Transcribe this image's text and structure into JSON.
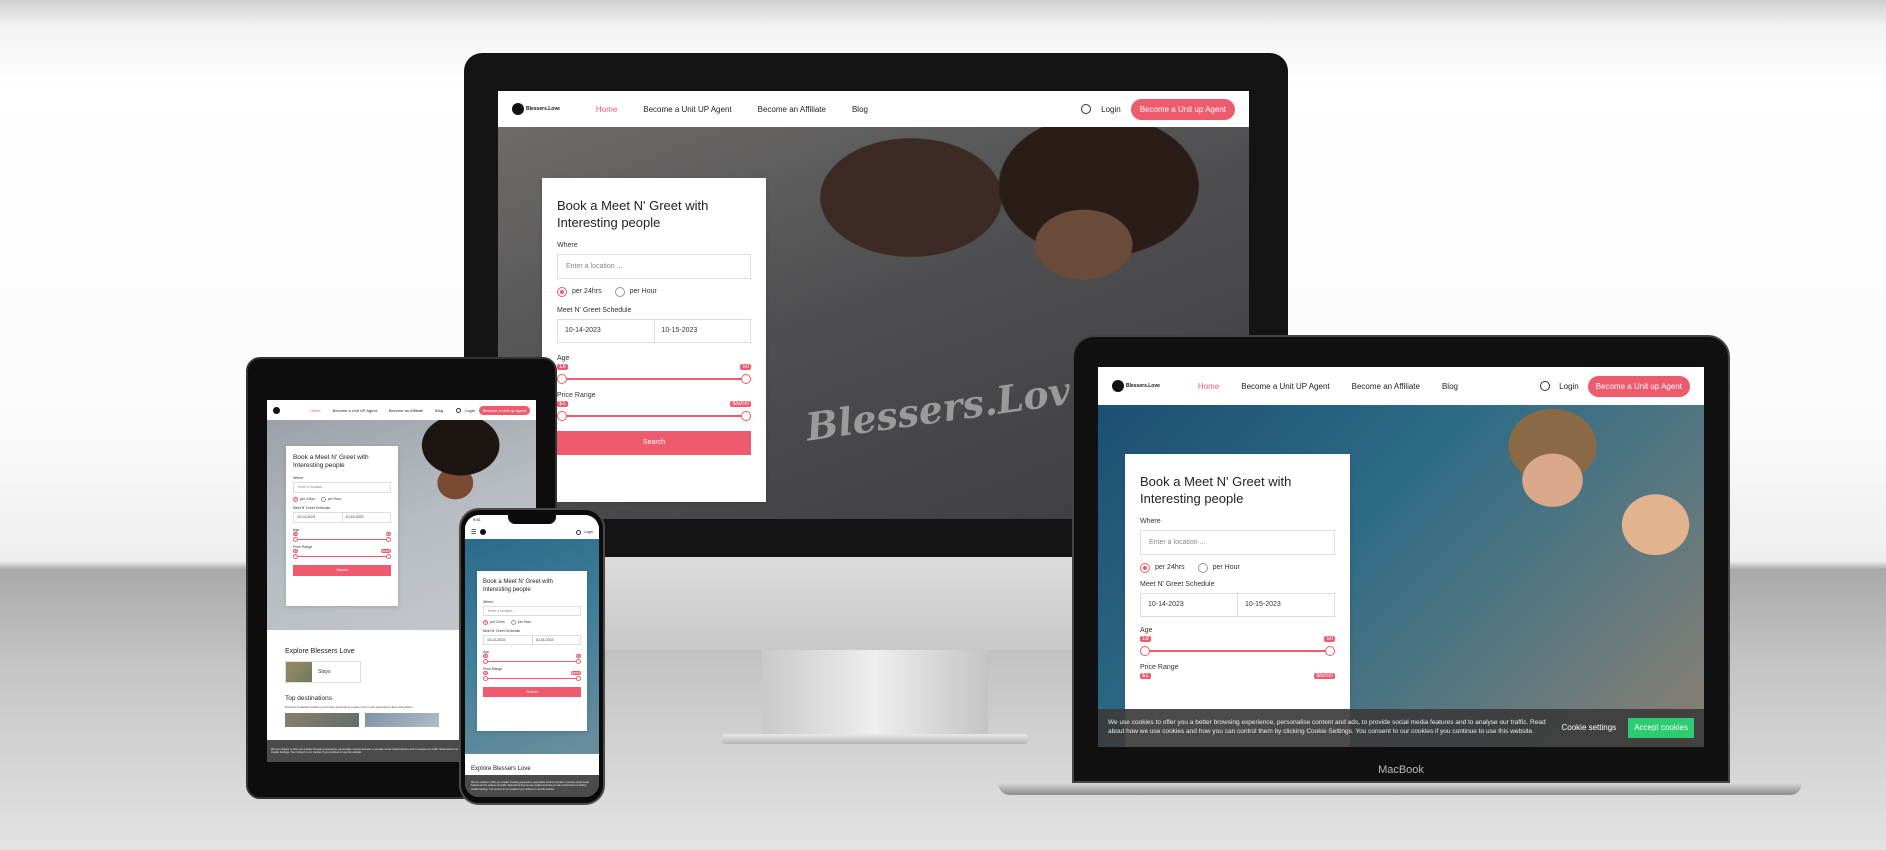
{
  "site": {
    "logo_text": "Blessers.Love",
    "nav": [
      "Home",
      "Become a Unit UP Agent",
      "Become an Affiliate",
      "Blog"
    ],
    "login": "Login",
    "cta": "Become a Unit up Agent",
    "card_title": "Book a Meet N' Greet with Interesting people",
    "where_label": "Where",
    "location_placeholder": "Enter a location ...",
    "rate_24": "per 24hrs",
    "rate_hour": "per Hour",
    "schedule_label": "Meet N' Greet Schedule",
    "date_from": "10-14-2023",
    "date_to": "10-15-2023",
    "age_label": "Age",
    "age_min": "18",
    "age_max": "50",
    "age_range": [
      18,
      50
    ],
    "price_label": "Price Range",
    "price_min": "$1",
    "price_max": "$5000",
    "search": "Search",
    "shirt_text": "Blessers.Love",
    "cookie_text": "We use cookies to offer you a better browsing experience, personalise content and ads, to provide social media features and to analyse our traffic. Read about how we use cookies and how you can control them by clicking Cookie Settings. You consent to our cookies if you continue to use this website.",
    "cookie_settings": "Cookie settings",
    "accept": "Accept cookies",
    "explore_title": "Explore Blessers Love",
    "explore_item": "Stays",
    "top_dest_title": "Top destinations",
    "top_dest_sub": "Discover beautiful locations and meet interesting people in the most interesting cities and places",
    "phone_time": "9:41"
  },
  "devices": {
    "laptop_label": "MacBook"
  },
  "colors": {
    "accent": "#ef5b6e",
    "accept": "#2ecc71"
  }
}
